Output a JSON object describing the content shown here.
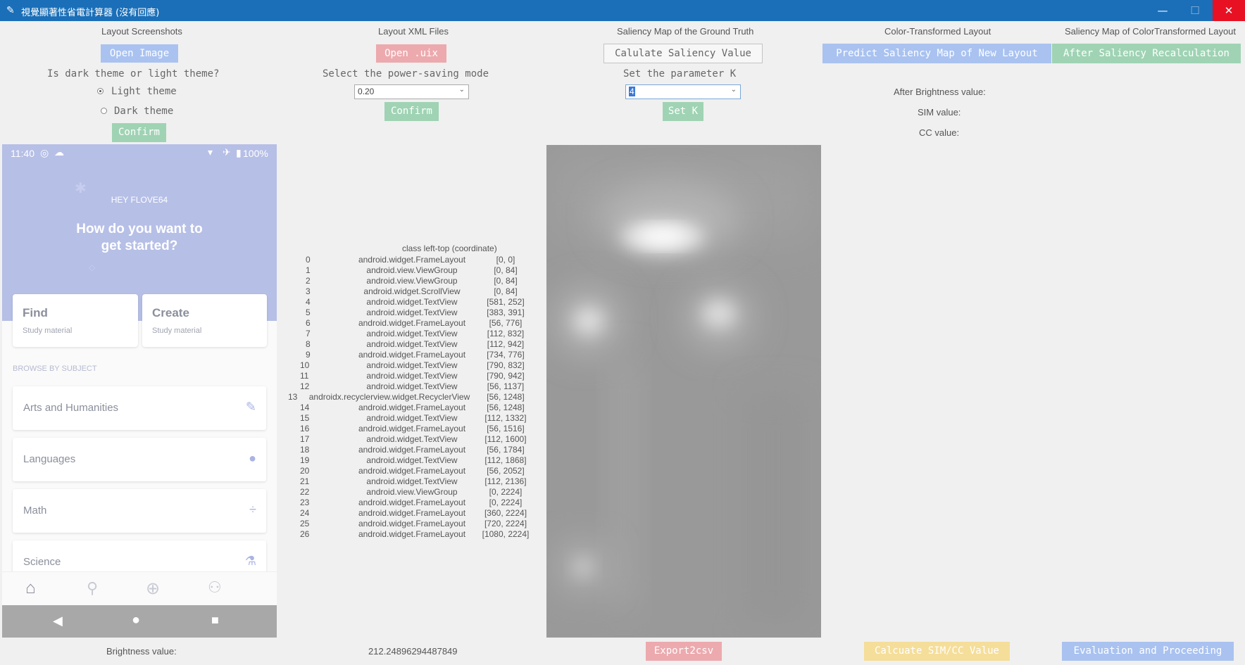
{
  "window": {
    "title": "視覺顯著性省電計算器 (沒有回應)",
    "minimize": "—",
    "maximize": "☐",
    "close": "✕"
  },
  "headers": {
    "layout_screenshots": "Layout Screenshots",
    "layout_xml": "Layout XML Files",
    "saliency_gt": "Saliency Map of the Ground Truth",
    "color_transformed": "Color-Transformed Layout",
    "saliency_ct": "Saliency Map of ColorTransformed Layout"
  },
  "buttons": {
    "open_image": "Open Image",
    "open_uix": "Open .uix",
    "calc_saliency": "Calulate Saliency Value",
    "predict_saliency": "Predict Saliency Map of New Layout",
    "after_saliency": "After Saliency Recalculation",
    "confirm_theme": "Confirm",
    "confirm_mode": "Confirm",
    "set_k": "Set K",
    "export_csv": "Export2csv",
    "calc_sim_cc": "Calcuate SIM/CC Value",
    "evaluation": "Evaluation and Proceeding"
  },
  "theme": {
    "question": "Is dark theme or light theme?",
    "light": "Light theme",
    "dark": "Dark theme",
    "selected": "light"
  },
  "power": {
    "label": "Select the power-saving mode",
    "value": "0.20"
  },
  "param_k": {
    "label": "Set the parameter K",
    "value": "4"
  },
  "results": {
    "after_brightness": "After Brightness value:",
    "sim": "SIM value:",
    "cc": "CC value:",
    "brightness_label": "Brightness value:",
    "brightness_value": "212.24896294487849"
  },
  "tree_header": "class left-top (coordinate)",
  "tree": [
    [
      "0",
      "android.widget.FrameLayout",
      "[0, 0]"
    ],
    [
      "1",
      "android.view.ViewGroup",
      "[0, 84]"
    ],
    [
      "2",
      "android.view.ViewGroup",
      "[0, 84]"
    ],
    [
      "3",
      "android.widget.ScrollView",
      "[0, 84]"
    ],
    [
      "4",
      "android.widget.TextView",
      "[581, 252]"
    ],
    [
      "5",
      "android.widget.TextView",
      "[383, 391]"
    ],
    [
      "6",
      "android.widget.FrameLayout",
      "[56, 776]"
    ],
    [
      "7",
      "android.widget.TextView",
      "[112, 832]"
    ],
    [
      "8",
      "android.widget.TextView",
      "[112, 942]"
    ],
    [
      "9",
      "android.widget.FrameLayout",
      "[734, 776]"
    ],
    [
      "10",
      "android.widget.TextView",
      "[790, 832]"
    ],
    [
      "11",
      "android.widget.TextView",
      "[790, 942]"
    ],
    [
      "12",
      "android.widget.TextView",
      "[56, 1137]"
    ],
    [
      "13",
      "androidx.recyclerview.widget.RecyclerView",
      "[56, 1248]"
    ],
    [
      "14",
      "android.widget.FrameLayout",
      "[56, 1248]"
    ],
    [
      "15",
      "android.widget.TextView",
      "[112, 1332]"
    ],
    [
      "16",
      "android.widget.FrameLayout",
      "[56, 1516]"
    ],
    [
      "17",
      "android.widget.TextView",
      "[112, 1600]"
    ],
    [
      "18",
      "android.widget.FrameLayout",
      "[56, 1784]"
    ],
    [
      "19",
      "android.widget.TextView",
      "[112, 1868]"
    ],
    [
      "20",
      "android.widget.FrameLayout",
      "[56, 2052]"
    ],
    [
      "21",
      "android.widget.TextView",
      "[112, 2136]"
    ],
    [
      "22",
      "android.view.ViewGroup",
      "[0, 2224]"
    ],
    [
      "23",
      "android.widget.FrameLayout",
      "[0, 2224]"
    ],
    [
      "24",
      "android.widget.FrameLayout",
      "[360, 2224]"
    ],
    [
      "25",
      "android.widget.FrameLayout",
      "[720, 2224]"
    ],
    [
      "26",
      "android.widget.FrameLayout",
      "[1080, 2224]"
    ]
  ],
  "phone": {
    "time": "11:40",
    "battery": "100%",
    "greeting": "HEY FLOVE64",
    "headline_1": "How do you want to",
    "headline_2": "get started?",
    "card_find": "Find",
    "card_find_sub": "Study material",
    "card_create": "Create",
    "card_create_sub": "Study material",
    "browse": "BROWSE BY SUBJECT",
    "subjects": [
      "Arts and Humanities",
      "Languages",
      "Math",
      "Science"
    ]
  }
}
